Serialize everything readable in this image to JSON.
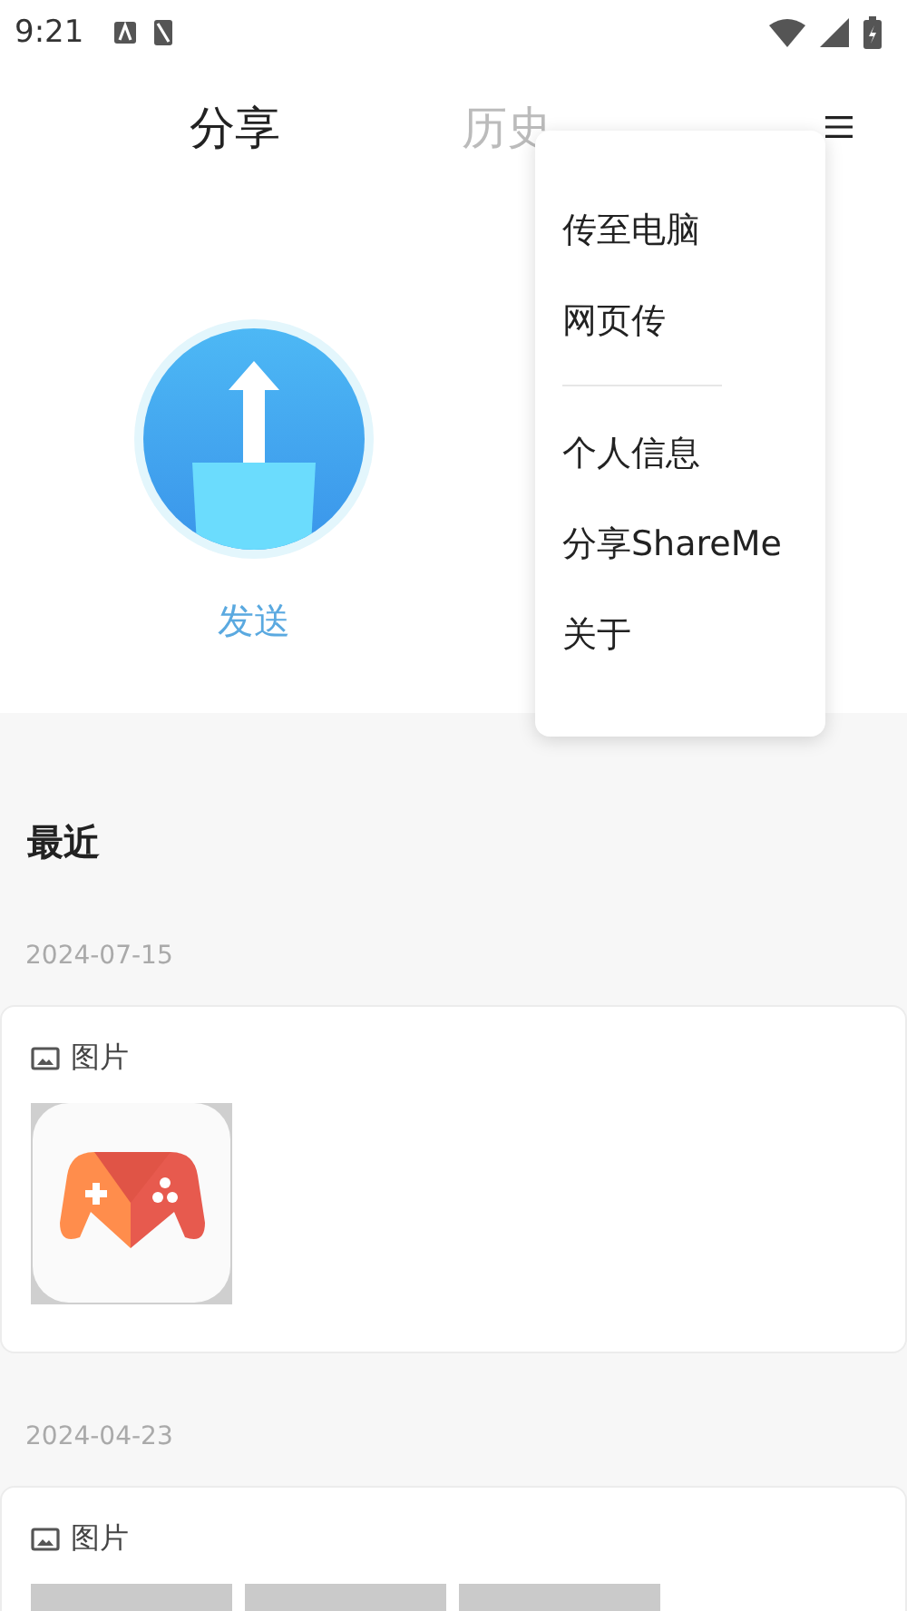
{
  "status_bar": {
    "time": "9:21"
  },
  "tabs": [
    {
      "label": "分享",
      "selected": true
    },
    {
      "label": "历史",
      "selected": false
    }
  ],
  "send": {
    "label": "发送"
  },
  "menu": {
    "groups": [
      {
        "items": [
          {
            "label": "传至电脑"
          },
          {
            "label": "网页传"
          }
        ]
      },
      {
        "items": [
          {
            "label": "个人信息"
          },
          {
            "label": "分享ShareMe"
          },
          {
            "label": "关于"
          }
        ]
      }
    ]
  },
  "recent": {
    "title": "最近",
    "groups": [
      {
        "date": "2024-07-15",
        "category": "图片"
      },
      {
        "date": "2024-04-23",
        "category": "图片",
        "thumbnails": [
          {
            "kind": "placeholder"
          },
          {
            "kind": "placeholder"
          },
          {
            "kind": "placeholder"
          }
        ]
      }
    ]
  }
}
